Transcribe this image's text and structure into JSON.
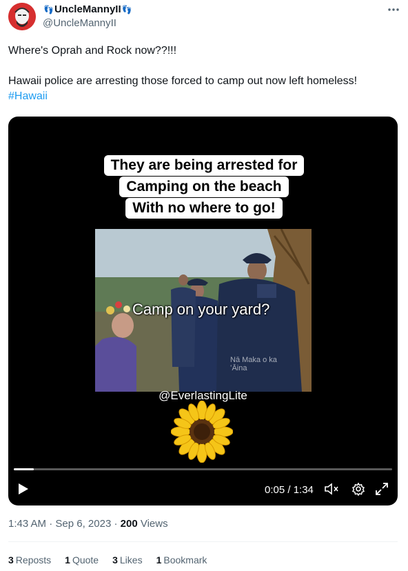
{
  "author": {
    "name": "UncleMannyII",
    "handle": "@UncleMannyII",
    "emoji_left": "👣",
    "emoji_right": "👣"
  },
  "tweet": {
    "text_line1": "Where's Oprah and Rock now??!!!",
    "text_line2": "Hawaii police are arresting those forced to camp out now left homeless!",
    "hashtag": "#Hawaii"
  },
  "video": {
    "caption_lines": [
      "They are being arrested for",
      "Camping on the beach",
      "With no where to go!"
    ],
    "frame_caption": "Camp on your yard?",
    "watermark": "Nā Maka o ka ʻĀina",
    "credit": "@EverlastingLite",
    "progress": 0.053,
    "time_display": "0:05 / 1:34"
  },
  "meta": {
    "time": "1:43 AM",
    "separator1": " · ",
    "date": "Sep 6, 2023",
    "separator2": " · ",
    "views_count": "200",
    "views_label": " Views"
  },
  "stats": {
    "reposts_count": "3",
    "reposts_label": "Reposts",
    "quotes_count": "1",
    "quotes_label": "Quote",
    "likes_count": "3",
    "likes_label": "Likes",
    "bookmarks_count": "1",
    "bookmarks_label": "Bookmark"
  },
  "icons": {
    "more": "more-icon",
    "play": "play-icon",
    "volume": "volume-muted-icon",
    "settings": "gear-icon",
    "fullscreen": "fullscreen-icon"
  },
  "colors": {
    "link": "#1d9bf0",
    "secondary": "#536471",
    "avatar_bg": "#d62f2f"
  }
}
